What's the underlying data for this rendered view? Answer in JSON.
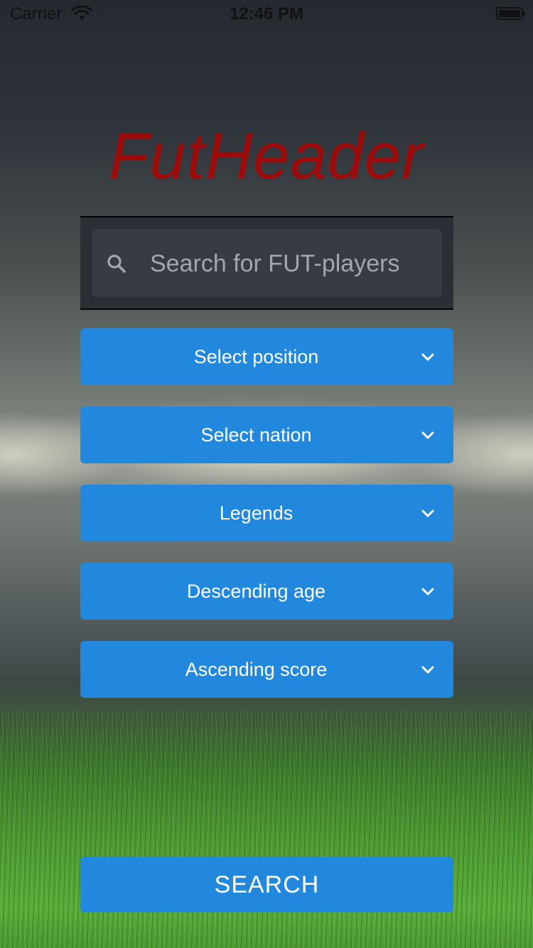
{
  "status_bar": {
    "carrier": "Carrier",
    "time": "12:46 PM"
  },
  "app": {
    "title": "FutHeader",
    "title_color": "#9c0a0a"
  },
  "search": {
    "placeholder": "Search for FUT-players",
    "value": "",
    "icon": "search-icon"
  },
  "filters": [
    {
      "label": "Select position",
      "icon": "chevron-down-icon"
    },
    {
      "label": "Select nation",
      "icon": "chevron-down-icon"
    },
    {
      "label": "Legends",
      "icon": "chevron-down-icon"
    },
    {
      "label": "Descending age",
      "icon": "chevron-down-icon"
    },
    {
      "label": "Ascending score",
      "icon": "chevron-down-icon"
    }
  ],
  "actions": {
    "search_label": "SEARCH",
    "accent_color": "#2288dd"
  }
}
